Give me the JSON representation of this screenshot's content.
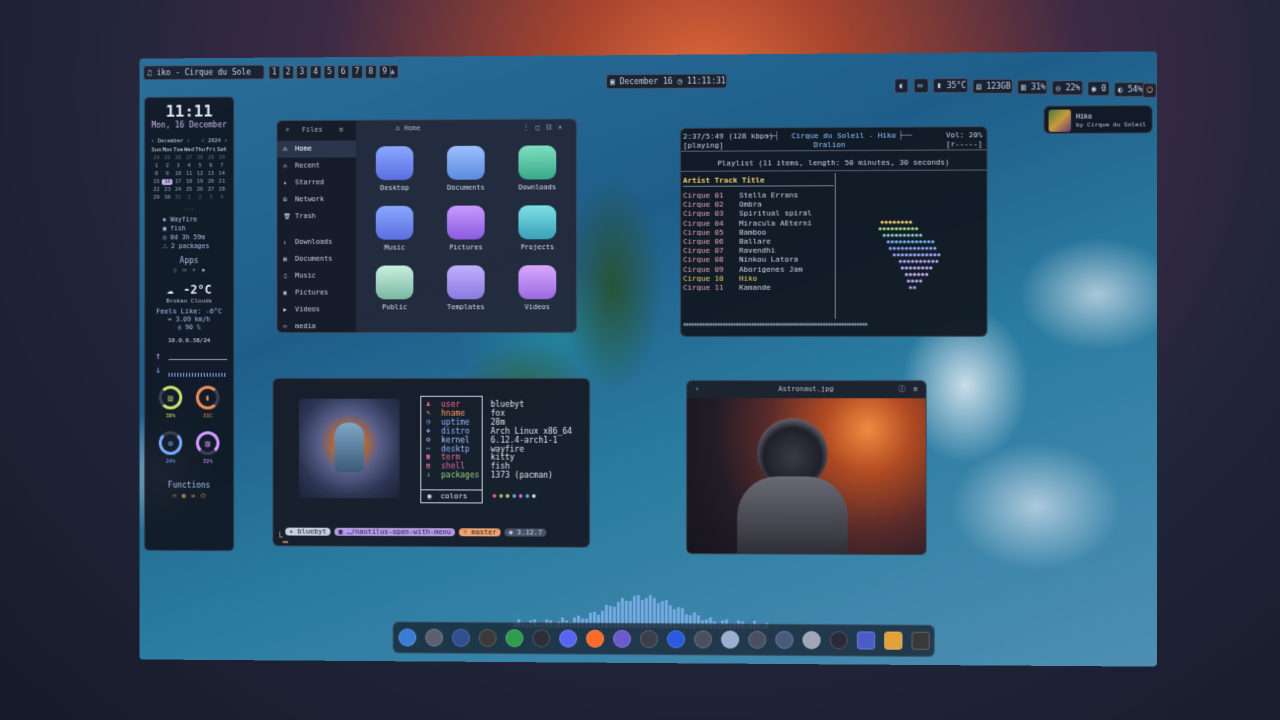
{
  "topbar": {
    "music": "iko - Cirque du Sole",
    "workspaces": [
      "1",
      "2",
      "3",
      "4",
      "5",
      "6",
      "7",
      "8",
      "9"
    ],
    "date": "December 16",
    "time": "11:11:31",
    "temp": "35°C",
    "disk": "123GB",
    "cpu": "31%",
    "mem": "22%",
    "net": "0",
    "battery": "54%"
  },
  "notification": {
    "title": "Hiko",
    "subtitle": "by Cirque du Soleil"
  },
  "sidebar": {
    "clock": "11:11",
    "date": "Mon, 16 December",
    "month": "December",
    "year": "2024",
    "weekdays": [
      "Sun",
      "Mon",
      "Tue",
      "Wed",
      "Thu",
      "Fri",
      "Sat"
    ],
    "days": [
      "24",
      "25",
      "26",
      "27",
      "28",
      "29",
      "30",
      "1",
      "2",
      "3",
      "4",
      "5",
      "6",
      "7",
      "8",
      "9",
      "10",
      "11",
      "12",
      "13",
      "14",
      "15",
      "16",
      "17",
      "18",
      "19",
      "20",
      "21",
      "22",
      "23",
      "24",
      "25",
      "26",
      "27",
      "28",
      "29",
      "30",
      "31",
      "1",
      "2",
      "3",
      "4"
    ],
    "dots": "...",
    "wm": "Wayfire",
    "shell": "fish",
    "uptime": "0d 3h 59m",
    "packages": "2 packages",
    "apps_title": "Apps",
    "weather_temp": "-2°C",
    "weather_desc": "Broken Clouds",
    "feels": "Feels Like: -6°C",
    "wind": "3.09 km/h",
    "humidity": "90 %",
    "ip": "10.0.0.38/24",
    "gauges": [
      "38%",
      "33C",
      "24%",
      "32%"
    ],
    "functions": "Functions"
  },
  "files": {
    "title": "Files",
    "path": "Home",
    "sidebar": [
      "Home",
      "Recent",
      "Starred",
      "Network",
      "Trash",
      "Downloads",
      "Documents",
      "Music",
      "Pictures",
      "Videos",
      "media"
    ],
    "folders": [
      "Desktop",
      "Documents",
      "Downloads",
      "Music",
      "Pictures",
      "Projects",
      "Public",
      "Templates",
      "Videos"
    ]
  },
  "music": {
    "status": "2:37/5:49 (128 kbps)",
    "song": "Cirque du Soleil - Hiko",
    "album": "Dralion",
    "vol": "Vol: 20%",
    "state": "[playing]",
    "flags": "[r-----]",
    "playlist": "Playlist (11 items, length: 50 minutes, 30 seconds)",
    "header": "Artist Track Title",
    "tracks": [
      [
        "Cirque 01",
        "Stella Errans"
      ],
      [
        "Cirque 02",
        "Ombra"
      ],
      [
        "Cirque 03",
        "Spiritual spiral"
      ],
      [
        "Cirque 04",
        "Miracula AEterni"
      ],
      [
        "Cirque 05",
        "Bamboo"
      ],
      [
        "Cirque 06",
        "Ballare"
      ],
      [
        "Cirque 07",
        "Ravendhi"
      ],
      [
        "Cirque 08",
        "Ninkou Latora"
      ],
      [
        "Cirque 09",
        "Aborigenes Jam"
      ],
      [
        "Cirque 10",
        "Hiko"
      ],
      [
        "Cirque 11",
        "Kamande"
      ]
    ]
  },
  "fetch": {
    "labels": [
      "user",
      "hname",
      "uptime",
      "distro",
      "kernel",
      "desktp",
      "term",
      "shell",
      "packages"
    ],
    "values": [
      "bluebyt",
      "fox",
      "28m",
      "Arch Linux x86_64",
      "6.12.4-arch1-1",
      "wayfire",
      "kitty",
      "fish",
      "1373 (pacman)"
    ],
    "colors": "colors",
    "prompt_user": "bluebyt",
    "prompt_dir": "…/nautilus-open-with-menu",
    "prompt_branch": "master",
    "prompt_ver": "3.12.7"
  },
  "viewer": {
    "title": "Astronaut.jpg"
  }
}
